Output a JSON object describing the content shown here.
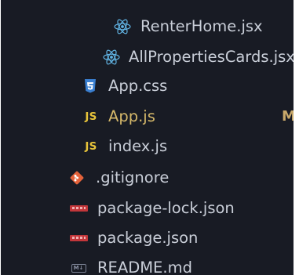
{
  "explorer": {
    "files": [
      {
        "name": "RenterHome.jsx",
        "icon": "react-icon"
      },
      {
        "name": "AllPropertiesCards.jsx",
        "icon": "react-icon"
      },
      {
        "name": "App.css",
        "icon": "css-icon"
      },
      {
        "name": "App.js",
        "icon": "javascript-icon",
        "status": "M"
      },
      {
        "name": "index.js",
        "icon": "javascript-icon"
      },
      {
        "name": ".gitignore",
        "icon": "git-icon"
      },
      {
        "name": "package-lock.json",
        "icon": "npm-icon"
      },
      {
        "name": "package.json",
        "icon": "npm-icon"
      },
      {
        "name": "README.md",
        "icon": "markdown-icon"
      }
    ],
    "js_icon_text": "JS",
    "md_icon_text": "M↓"
  },
  "colors": {
    "panel_background": "#181b24",
    "file_text": "#c9ced8",
    "modified_text": "#d5b86a",
    "react_icon": "#61b4e4",
    "css_icon": "#3a7fd0",
    "js_icon": "#e6c33a",
    "git_icon": "#e4623a",
    "npm_icon": "#c2363a"
  }
}
